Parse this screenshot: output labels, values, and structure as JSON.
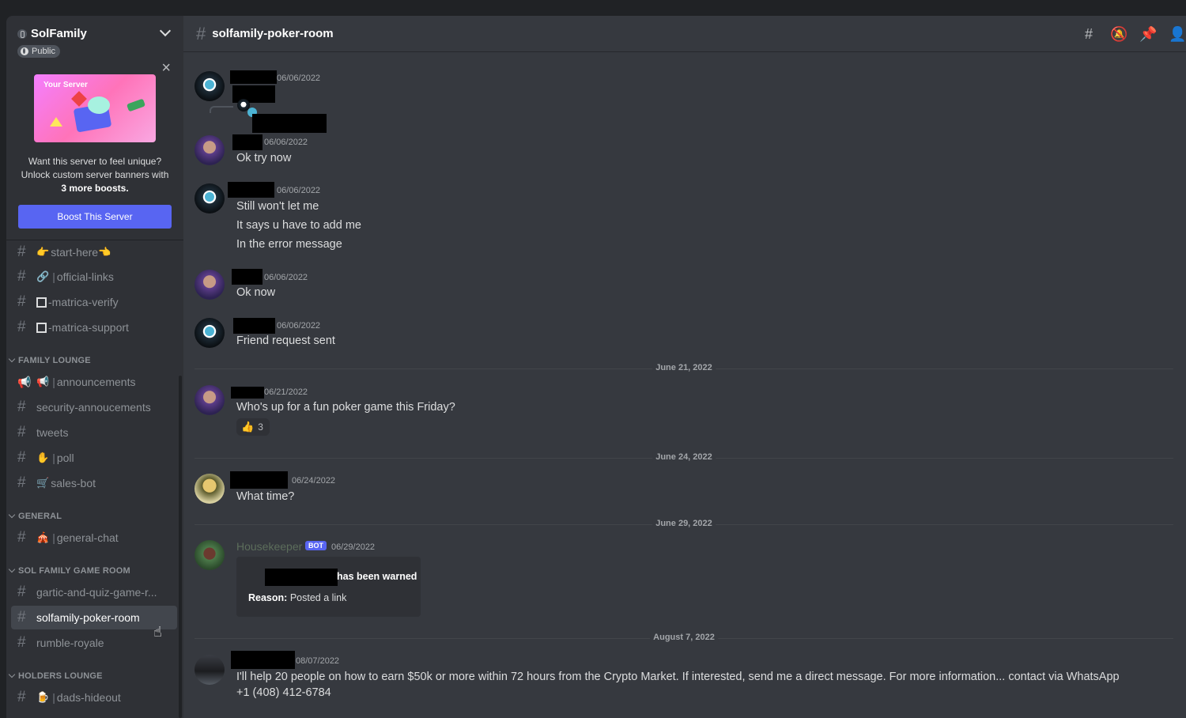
{
  "server": {
    "name": "SolFamily",
    "visibility": "Public"
  },
  "boost": {
    "banner_label": "Your Server",
    "text_line1": "Want this server to feel unique?",
    "text_line2": "Unlock custom server banners with",
    "text_bold": "3 more boosts.",
    "button": "Boost This Server"
  },
  "sidebar": {
    "channels_top": [
      {
        "name": "start-here",
        "prefix": "👉",
        "suffix": "👈"
      },
      {
        "name": "official-links",
        "prefix": "🔗"
      },
      {
        "name": "-matrica-verify"
      },
      {
        "name": "-matrica-support"
      }
    ],
    "categories": [
      {
        "name": "FAMILY LOUNGE"
      },
      {
        "name": "GENERAL"
      },
      {
        "name": "SOL FAMILY GAME ROOM"
      },
      {
        "name": "HOLDERS LOUNGE"
      }
    ],
    "family_lounge": [
      {
        "name": "announcements",
        "prefix": "📢"
      },
      {
        "name": "security-annoucements"
      },
      {
        "name": "tweets"
      },
      {
        "name": "poll",
        "prefix": "✋"
      },
      {
        "name": "sales-bot",
        "prefix": "🛒"
      }
    ],
    "general": [
      {
        "name": "general-chat",
        "prefix": "🎪"
      }
    ],
    "game_room": [
      {
        "name": "gartic-and-quiz-game-r..."
      },
      {
        "name": "solfamily-poker-room"
      },
      {
        "name": "rumble-royale"
      }
    ],
    "holders": [
      {
        "name": "dads-hideout",
        "prefix": "🍺"
      }
    ],
    "separator": "|"
  },
  "channel": {
    "name": "solfamily-poker-room",
    "hash": "#"
  },
  "header_icons": [
    "threads-icon",
    "mute-icon",
    "pin-icon",
    "members-icon"
  ],
  "messages": [
    {
      "timestamp": "06/06/2022",
      "text": ""
    },
    {
      "timestamp": "06/06/2022",
      "text": "Ok try now"
    },
    {
      "timestamp": "06/06/2022",
      "lines": [
        "Still won't let me",
        "It says u have to add me",
        "In the error message"
      ]
    },
    {
      "timestamp": "06/06/2022",
      "text": "Ok now"
    },
    {
      "timestamp": "06/06/2022",
      "text": "Friend request sent"
    },
    {
      "timestamp": "06/21/2022",
      "text": "Who's up for a fun poker game this Friday?",
      "reaction": {
        "emoji": "👍",
        "count": "3"
      }
    },
    {
      "timestamp": "06/24/2022",
      "text": "What time?"
    },
    {
      "author": "Housekeeper",
      "bot_tag": "BOT",
      "timestamp": "06/29/2022",
      "embed": {
        "title": "has been warned",
        "reason_label": "Reason:",
        "reason": "Posted a link"
      }
    },
    {
      "timestamp": "08/07/2022",
      "lines": [
        "I'll help 20 people on how to earn $50k or more within 72 hours from the Crypto Market. If interested, send me a direct message. For more information... contact via WhatsApp",
        "+1 (408) 412-6784"
      ]
    }
  ],
  "date_dividers": [
    "June 21, 2022",
    "June 24, 2022",
    "June 29, 2022",
    "August 7, 2022"
  ]
}
